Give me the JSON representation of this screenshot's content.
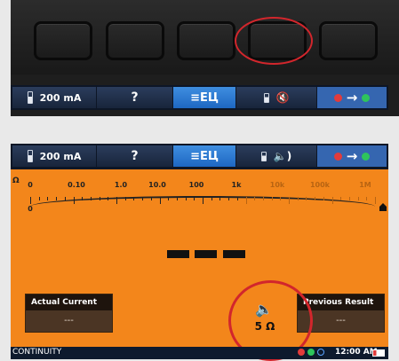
{
  "top": {
    "tabs": {
      "current": "200 mA",
      "help": "?",
      "menu": "≡ЕЦ",
      "mute": "🔇",
      "arrow": "→"
    }
  },
  "bottom": {
    "tabs": {
      "current": "200 mA",
      "help": "?",
      "menu": "≡ЕЦ",
      "speaker": "🔈)",
      "arrow": "→"
    },
    "scale": {
      "upper_labels": [
        "0",
        "0.10",
        "1.0",
        "10.0",
        "100",
        "1k",
        "10k",
        "100k",
        "1M"
      ],
      "unit_label": "Ω",
      "lower_label": "0"
    },
    "reading": "— — —",
    "actual_current": {
      "header": "Actual Current",
      "value": "---"
    },
    "previous_result": {
      "header": "Previous Result",
      "value": "---"
    },
    "speaker_value": "5 Ω",
    "status": {
      "mode": "CONTINUITY",
      "time": "12:00 AM"
    }
  },
  "colors": {
    "screen": "#f3861b",
    "accent_red": "#d2262c",
    "tab_blue": "#1e67c2"
  }
}
